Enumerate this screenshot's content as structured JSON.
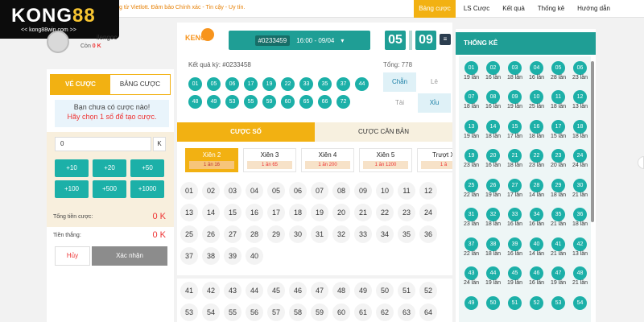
{
  "ticker": "g từ Vietlott. Đảm bảo Chính xác - Tin cậy - Uy tín.",
  "nav": [
    "Bảng cược",
    "LS Cược",
    "Kết quả",
    "Thống kê",
    "Hướng dẫn"
  ],
  "logo": {
    "brand_a": "KONG",
    "brand_b": "88",
    "site": "<< kong88win.com >>"
  },
  "user": {
    "name": "ilengoc",
    "balance_label": "Còn",
    "balance": "0 K"
  },
  "left": {
    "tab_active": "VÉ CƯỢC",
    "tab_other": "BẢNG CƯỢC",
    "notice_line1": "Bạn chưa có cược nào!",
    "notice_line2": "Hãy chọn 1 số để tạo cược.",
    "amount": "0",
    "amount_unit": "K",
    "chips": [
      "+10",
      "+20",
      "+50",
      "+100",
      "+500",
      "+1000"
    ],
    "total_label": "Tổng tiền cược:",
    "total_value": "0 K",
    "win_label": "Tiền thắng:",
    "win_value": "0 K",
    "cancel": "Hủy",
    "confirm": "Xác nhận"
  },
  "center": {
    "draw_code": "#0233459",
    "draw_time": "16:00 - 09/04",
    "timer_min": "05",
    "timer_sec": "09",
    "result_label": "Kết quả kỳ: #0233458",
    "total_label": "Tổng: 778",
    "results": [
      "01",
      "05",
      "06",
      "17",
      "19",
      "22",
      "33",
      "35",
      "37",
      "44",
      "48",
      "49",
      "53",
      "55",
      "59",
      "60",
      "65",
      "66",
      "72"
    ],
    "stats": [
      "Chẵn",
      "Lẻ",
      "Tài",
      "Xỉu"
    ],
    "sub_tab_active": "CƯỢC SỐ",
    "sub_tab_other": "CƯỢC CĂN BẢN",
    "bet_types": [
      {
        "name": "Xiên 2",
        "rate": "1 ăn 16"
      },
      {
        "name": "Xiên 3",
        "rate": "1 ăn 65"
      },
      {
        "name": "Xiên 4",
        "rate": "1 ăn 200"
      },
      {
        "name": "Xiên 5",
        "rate": "1 ăn 1200"
      },
      {
        "name": "Trượt X",
        "rate": "1 ă"
      }
    ],
    "numbers_a": [
      "01",
      "02",
      "03",
      "04",
      "05",
      "06",
      "07",
      "08",
      "09",
      "10",
      "11",
      "12",
      "13",
      "14",
      "15",
      "16",
      "17",
      "18",
      "19",
      "20",
      "21",
      "22",
      "23",
      "24",
      "25",
      "26",
      "27",
      "28",
      "29",
      "30",
      "31",
      "32",
      "33",
      "34",
      "35",
      "36",
      "37",
      "38",
      "39",
      "40"
    ],
    "numbers_b": [
      "41",
      "42",
      "43",
      "44",
      "45",
      "46",
      "47",
      "48",
      "49",
      "50",
      "51",
      "52",
      "53",
      "54",
      "55",
      "56",
      "57",
      "58",
      "59",
      "60",
      "61",
      "62",
      "63",
      "64"
    ]
  },
  "right": {
    "title": "THỐNG KÊ",
    "stats": [
      {
        "n": "01",
        "c": "19 lần"
      },
      {
        "n": "02",
        "c": "16 lần"
      },
      {
        "n": "03",
        "c": "18 lần"
      },
      {
        "n": "04",
        "c": "16 lần"
      },
      {
        "n": "05",
        "c": "28 lần"
      },
      {
        "n": "06",
        "c": "23 lần"
      },
      {
        "n": "07",
        "c": "18 lần"
      },
      {
        "n": "08",
        "c": "16 lần"
      },
      {
        "n": "09",
        "c": "19 lần"
      },
      {
        "n": "10",
        "c": "25 lần"
      },
      {
        "n": "11",
        "c": "18 lần"
      },
      {
        "n": "12",
        "c": "13 lần"
      },
      {
        "n": "13",
        "c": "19 lần"
      },
      {
        "n": "14",
        "c": "18 lần"
      },
      {
        "n": "15",
        "c": "17 lần"
      },
      {
        "n": "16",
        "c": "18 lần"
      },
      {
        "n": "17",
        "c": "15 lần"
      },
      {
        "n": "18",
        "c": "18 lần"
      },
      {
        "n": "19",
        "c": "23 lần"
      },
      {
        "n": "20",
        "c": "16 lần"
      },
      {
        "n": "21",
        "c": "18 lần"
      },
      {
        "n": "22",
        "c": "23 lần"
      },
      {
        "n": "23",
        "c": "20 lần"
      },
      {
        "n": "24",
        "c": "24 lần"
      },
      {
        "n": "25",
        "c": "22 lần"
      },
      {
        "n": "26",
        "c": "19 lần"
      },
      {
        "n": "27",
        "c": "17 lần"
      },
      {
        "n": "28",
        "c": "14 lần"
      },
      {
        "n": "29",
        "c": "18 lần"
      },
      {
        "n": "30",
        "c": "21 lần"
      },
      {
        "n": "31",
        "c": "23 lần"
      },
      {
        "n": "32",
        "c": "18 lần"
      },
      {
        "n": "33",
        "c": "16 lần"
      },
      {
        "n": "34",
        "c": "16 lần"
      },
      {
        "n": "35",
        "c": "21 lần"
      },
      {
        "n": "36",
        "c": "18 lần"
      },
      {
        "n": "37",
        "c": "22 lần"
      },
      {
        "n": "38",
        "c": "18 lần"
      },
      {
        "n": "39",
        "c": "16 lần"
      },
      {
        "n": "40",
        "c": "14 lần"
      },
      {
        "n": "41",
        "c": "21 lần"
      },
      {
        "n": "42",
        "c": "13 lần"
      },
      {
        "n": "43",
        "c": "24 lần"
      },
      {
        "n": "44",
        "c": "19 lần"
      },
      {
        "n": "45",
        "c": "19 lần"
      },
      {
        "n": "46",
        "c": "16 lần"
      },
      {
        "n": "47",
        "c": "19 lần"
      },
      {
        "n": "48",
        "c": "21 lần"
      },
      {
        "n": "49",
        "c": ""
      },
      {
        "n": "50",
        "c": ""
      },
      {
        "n": "51",
        "c": ""
      },
      {
        "n": "52",
        "c": ""
      },
      {
        "n": "53",
        "c": ""
      },
      {
        "n": "54",
        "c": ""
      }
    ]
  },
  "colors": {
    "accent": "#f2b112",
    "teal": "#1cb0a8",
    "red": "#e33"
  }
}
